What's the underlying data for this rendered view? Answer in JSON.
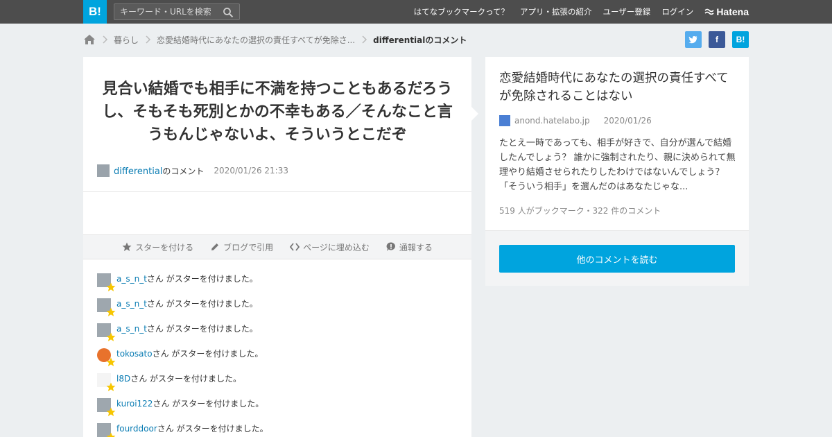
{
  "topbar": {
    "logo": "B!",
    "search_placeholder": "キーワード・URLを検索",
    "nav": [
      "はてなブックマークって？",
      "アプリ・拡張の紹介",
      "ユーザー登録",
      "ログイン"
    ],
    "brand": "Hatena"
  },
  "breadcrumb": {
    "items": [
      "暮らし",
      "恋愛結婚時代にあなたの選択の責任すべてが免除さ..."
    ],
    "current": "differentialのコメント"
  },
  "share": {
    "twitter": "t",
    "facebook": "f",
    "hatebu": "B!"
  },
  "comment": {
    "text": "見合い結婚でも相手に不満を持つこともあるだろうし、そもそも死別とかの不幸もある／そんなこと言うもんじゃないよ、そういうとこだぞ",
    "user": "differential",
    "user_suffix": "のコメント",
    "datetime": "2020/01/26 21:33"
  },
  "actions": [
    "スターを付ける",
    "ブログで引用",
    "ページに埋め込む",
    "通報する"
  ],
  "star_suffix": "さん がスターを付けました。",
  "stars": [
    {
      "name": "a_s_n_t"
    },
    {
      "name": "a_s_n_t"
    },
    {
      "name": "a_s_n_t"
    },
    {
      "name": "tokosato"
    },
    {
      "name": "l8D"
    },
    {
      "name": "kuroi122"
    },
    {
      "name": "fourddoor"
    }
  ],
  "entry": {
    "title": "恋愛結婚時代にあなたの選択の責任すべてが免除されることはない",
    "source": "anond.hatelabo.jp",
    "date": "2020/01/26",
    "excerpt": "たとえ一時であっても、相手が好きで、自分が選んで結婚したんでしょう？ 誰かに強制されたり、親に決められて無理やり結婚させられたりしたわけではないんでしょう？「そういう相手」を選んだのはあなたじゃな...",
    "counts": "519 人がブックマーク・322 件のコメント",
    "read_more": "他のコメントを読む"
  },
  "colors": {
    "accent": "#00a4de",
    "link": "#0a7cb3",
    "topbar": "#4d4d4d",
    "star": "#f7c600"
  }
}
